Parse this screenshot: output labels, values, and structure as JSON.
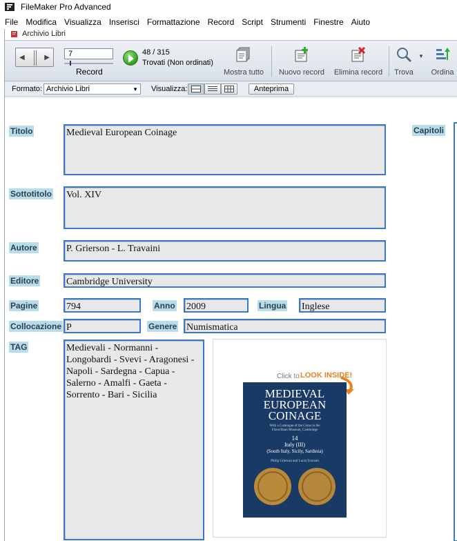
{
  "app": {
    "title": "FileMaker Pro Advanced"
  },
  "menu": {
    "items": [
      "File",
      "Modifica",
      "Visualizza",
      "Inserisci",
      "Formattazione",
      "Record",
      "Script",
      "Strumenti",
      "Finestre",
      "Aiuto"
    ]
  },
  "window": {
    "title": "Archivio Libri"
  },
  "toolbar": {
    "record_number": "7",
    "record_label": "Record",
    "found_count": "48 / 315",
    "found_status": "Trovati (Non ordinati)",
    "show_all_label": "Mostra tutto",
    "new_record_label": "Nuovo record",
    "delete_record_label": "Elimina record",
    "find_label": "Trova",
    "sort_label": "Ordina"
  },
  "formatbar": {
    "layout_label": "Formato:",
    "layout_value": "Archivio Libri",
    "view_label": "Visualizza:",
    "preview_label": "Anteprima"
  },
  "fields": {
    "titolo": {
      "label": "Titolo",
      "value": "Medieval European Coinage"
    },
    "sottotitolo": {
      "label": "Sottotitolo",
      "value": "Vol. XIV"
    },
    "autore": {
      "label": "Autore",
      "value": "P. Grierson - L. Travaini"
    },
    "editore": {
      "label": "Editore",
      "value": "Cambridge University"
    },
    "pagine": {
      "label": "Pagine",
      "value": "794"
    },
    "anno": {
      "label": "Anno",
      "value": "2009"
    },
    "lingua": {
      "label": "Lingua",
      "value": "Inglese"
    },
    "collocazione": {
      "label": "Collocazione",
      "value": "P"
    },
    "genere": {
      "label": "Genere",
      "value": "Numismatica"
    },
    "tag": {
      "label": "TAG",
      "value": "Medievali - Normanni - Longobardi - Svevi - Aragonesi - Napoli - Sardegna - Capua - Salerno - Amalfi - Gaeta - Sorrento - Bari - Sicilia"
    },
    "capitoli": {
      "label": "Capitoli"
    }
  },
  "cover": {
    "banner_click": "Click to",
    "banner_look": "LOOK INSIDE!",
    "title_line1": "MEDIEVAL",
    "title_line2": "EUROPEAN",
    "title_line3": "COINAGE",
    "subtitle_line1": "With a Catalogue of the Coins in the",
    "subtitle_line2": "Fitzwilliam Museum, Cambridge",
    "volume": "14",
    "region_line1": "Italy (III)",
    "region_line2": "(South Italy, Sicily, Sardinia)",
    "authors": "Philip Grierson and Lucia Travaini"
  },
  "colors": {
    "label_bg": "#b9dce9",
    "field_border": "#3a78c8",
    "field_bg": "#e8e8e8",
    "cover_bg": "#1a3a66",
    "banner_orange": "#e8821e"
  }
}
